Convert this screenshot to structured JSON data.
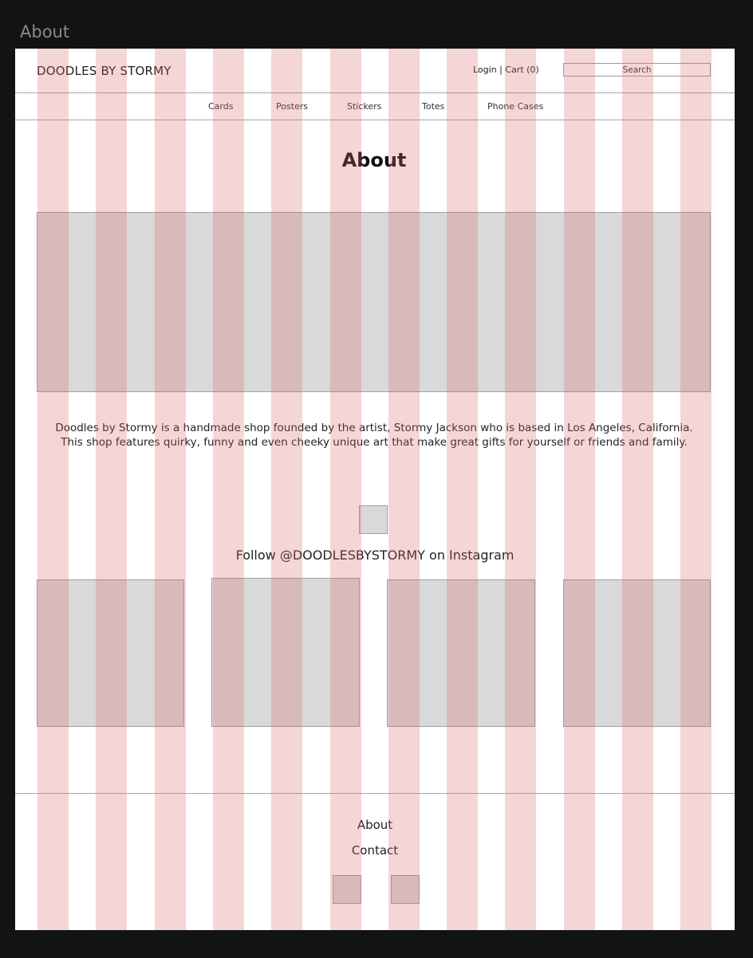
{
  "frame": {
    "label": "About"
  },
  "header": {
    "logo": "DOODLES BY STORMY",
    "login": "Login",
    "separator": " | ",
    "cart": "Cart (0)",
    "search_label": "Search"
  },
  "nav": {
    "items": [
      {
        "label": "Cards"
      },
      {
        "label": "Posters"
      },
      {
        "label": "Stickers"
      },
      {
        "label": "Totes"
      },
      {
        "label": "Phone Cases"
      }
    ]
  },
  "main": {
    "title": "About",
    "description_line1": "Doodles by Stormy is a handmade shop founded by the artist, Stormy Jackson who is based in Los Angeles, California.",
    "description_line2": "This shop features quirky, funny and even cheeky unique art that make great gifts for yourself or friends and family.",
    "instagram_text": "Follow @DOODLESBYSTORMY on Instagram"
  },
  "footer": {
    "links": [
      {
        "label": "About"
      },
      {
        "label": "Contact"
      }
    ]
  },
  "colors": {
    "background": "#121314",
    "artboard": "#ffffff",
    "grid_column": "#d86666",
    "placeholder": "#d9d9d9"
  }
}
